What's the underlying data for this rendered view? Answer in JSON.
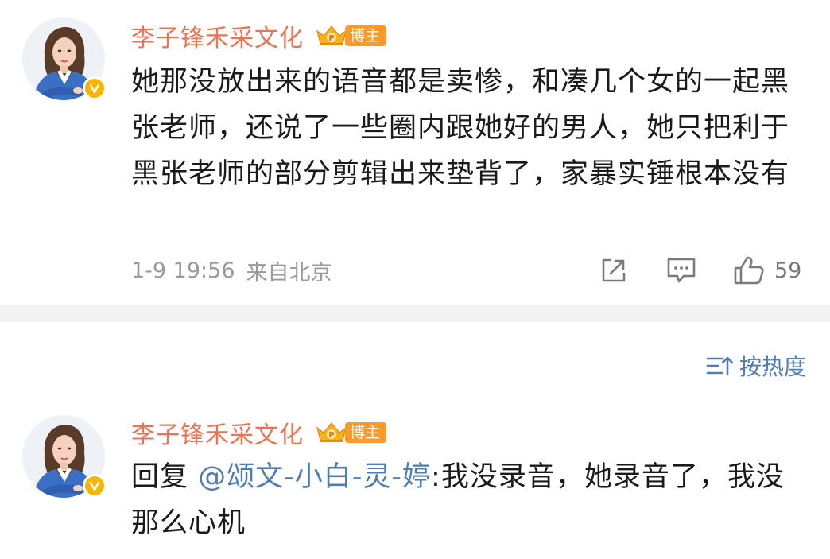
{
  "comments": [
    {
      "username": "李子锋禾采文化",
      "badge": "博主",
      "text": "她那没放出来的语音都是卖惨，和凑几个女的一起黑张老师，还说了一些圈内跟她好的男人，她只把利于黑张老师的部分剪辑出来垫背了，家暴实锤根本没有",
      "time": "1-9 19:56",
      "source": "来自北京",
      "like_count": "59",
      "icons": [
        "share-icon",
        "comment-icon",
        "like-icon"
      ]
    },
    {
      "username": "李子锋禾采文化",
      "badge": "博主",
      "reply_prefix": "回复 ",
      "mention": "@颂文-小白-灵-婷",
      "text": ":我没录音，她录音了，我没那么心机"
    }
  ],
  "sort": {
    "label": "按热度",
    "icon": "sort-icon"
  },
  "colors": {
    "username": "#eb7350",
    "badge": "#f89a2c",
    "link": "#507daf",
    "verify": "#f7b500",
    "meta": "#9a9a9a",
    "divider": "#f2f2f2"
  }
}
